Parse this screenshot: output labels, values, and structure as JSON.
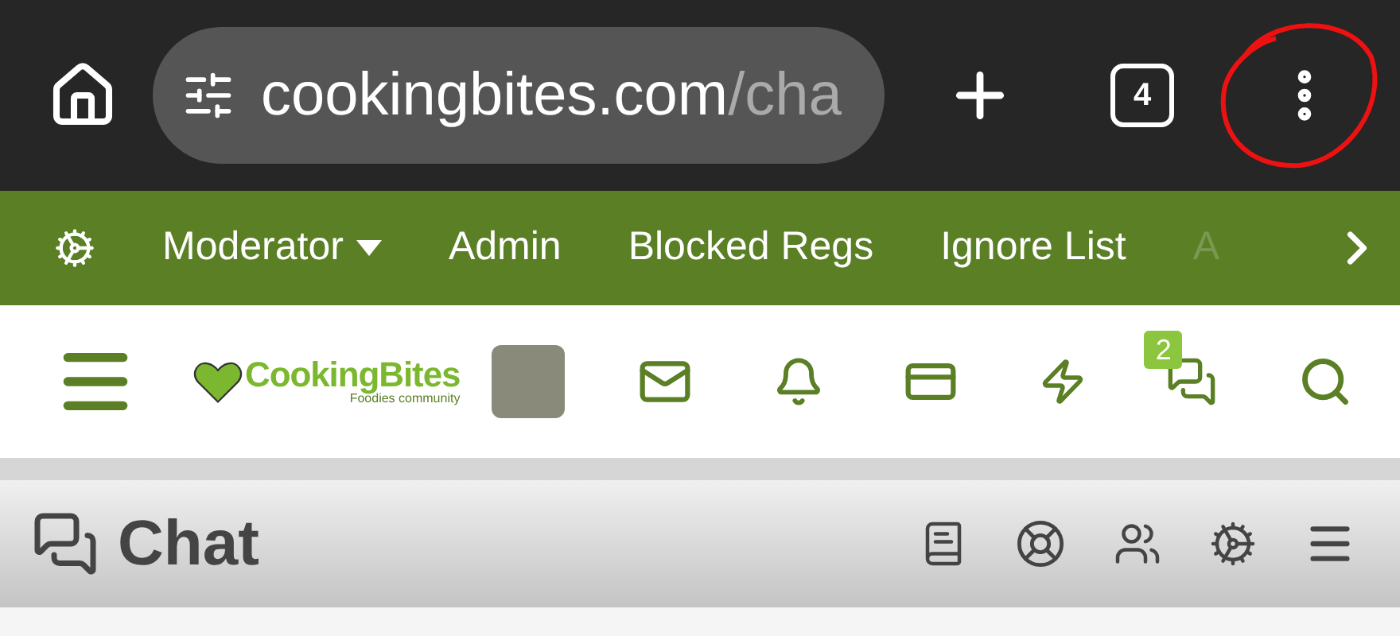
{
  "browser": {
    "url_host": "cookingbites.com",
    "url_path": "/cha",
    "tab_count": "4"
  },
  "nav": {
    "items": [
      {
        "label": "Moderator",
        "kind": "dropdown"
      },
      {
        "label": "Admin",
        "kind": "link"
      },
      {
        "label": "Blocked Regs",
        "kind": "link"
      },
      {
        "label": "Ignore List",
        "kind": "link"
      },
      {
        "label": "A",
        "kind": "faded"
      }
    ]
  },
  "header": {
    "logo": {
      "name": "CookingBites",
      "tagline": "Foodies community"
    },
    "conversations_badge": "2"
  },
  "chat": {
    "title": "Chat"
  }
}
